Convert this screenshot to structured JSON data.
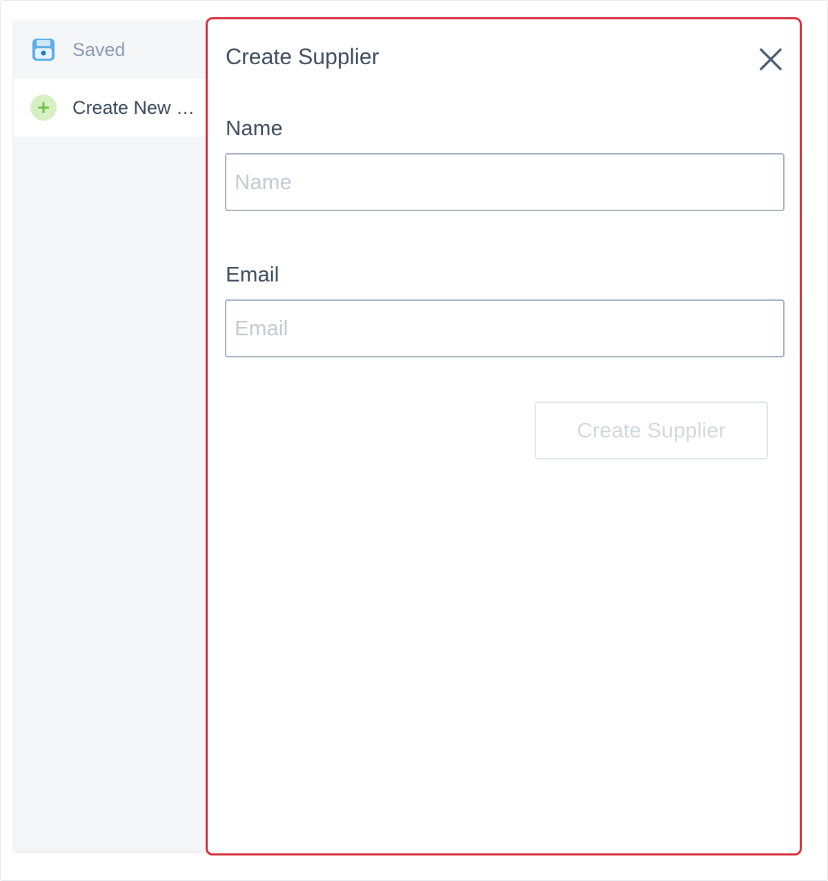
{
  "sidebar": {
    "items": [
      {
        "label": "Saved",
        "icon": "save-icon"
      },
      {
        "label": "Create New Supplier",
        "icon": "plus-icon"
      }
    ]
  },
  "dialog": {
    "title": "Create Supplier",
    "close_icon": "close-icon"
  },
  "form": {
    "name": {
      "label": "Name",
      "placeholder": "Name",
      "value": ""
    },
    "email": {
      "label": "Email",
      "placeholder": "Email",
      "value": ""
    },
    "submit_label": "Create Supplier",
    "submit_disabled": true
  },
  "colors": {
    "highlight_border": "#d52b35",
    "save_icon": "#5aaee8",
    "plus_icon_bg": "#d6efc4",
    "plus_icon_fg": "#6fc04a"
  }
}
